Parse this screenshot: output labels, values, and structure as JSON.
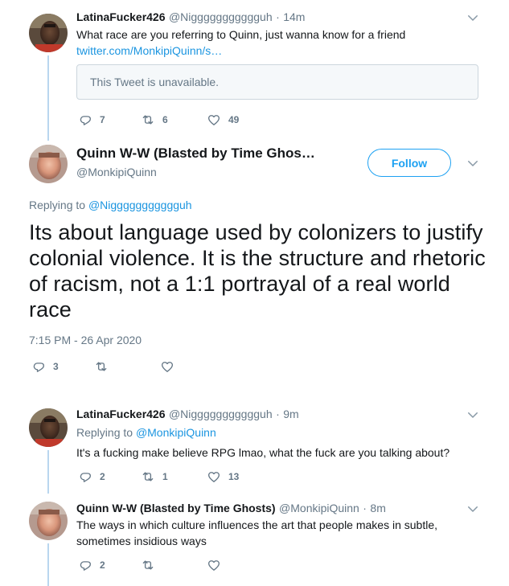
{
  "tweet1": {
    "name": "LatinaFucker426",
    "handle": "@Niggggggggggguh",
    "dot": "·",
    "time": "14m",
    "text": "What race are you referring to Quinn, just wanna know for a friend",
    "link": "twitter.com/MonkipiQuinn/s…",
    "quote": "This Tweet is unavailable.",
    "replies": "7",
    "retweets": "6",
    "likes": "49"
  },
  "main_tweet": {
    "name": "Quinn W-W (Blasted by Time Ghos…",
    "handle": "@MonkipiQuinn",
    "follow_label": "Follow",
    "replying_prefix": "Replying to",
    "replying_to": "@Niggggggggggguh",
    "text": "Its about language used by colonizers to justify colonial violence. It is the structure and rhetoric of racism, not a 1:1 portrayal of a real world race",
    "timestamp": "7:15 PM - 26 Apr 2020",
    "replies": "3"
  },
  "tweet3": {
    "name": "LatinaFucker426",
    "handle": "@Niggggggggggguh",
    "dot": "·",
    "time": "9m",
    "replying_prefix": "Replying to",
    "replying_to": "@MonkipiQuinn",
    "text": "It's a fucking make believe RPG lmao, what the fuck are you talking about?",
    "replies": "2",
    "retweets": "1",
    "likes": "13"
  },
  "tweet4": {
    "name": "Quinn W-W (Blasted by Time Ghosts)",
    "handle": "@MonkipiQuinn",
    "dot": "·",
    "time": "8m",
    "text": "The ways in which culture influences the art that people makes in subtle, sometimes insidious ways",
    "replies": "2"
  },
  "colors": {
    "accent": "#1da1f2",
    "link": "#1b95e0",
    "secondary_text": "#657786",
    "thread_line": "#b9d6ef"
  },
  "icons": [
    "chevron-down-icon",
    "reply-icon",
    "retweet-icon",
    "like-icon"
  ]
}
